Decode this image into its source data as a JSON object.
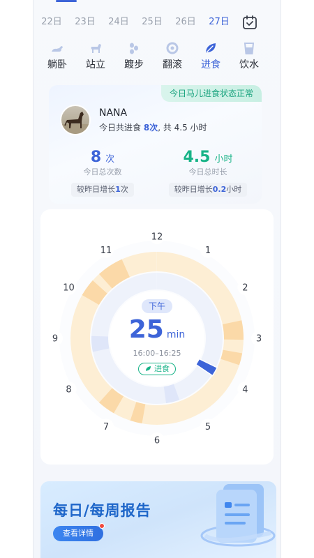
{
  "date_row": {
    "dates": [
      "22日",
      "23日",
      "24日",
      "25日",
      "26日",
      "27日"
    ],
    "active_index": 5
  },
  "categories": [
    {
      "label": "躺卧",
      "icon": "horse-lying-icon"
    },
    {
      "label": "站立",
      "icon": "horse-standing-icon"
    },
    {
      "label": "踱步",
      "icon": "hoofprints-icon"
    },
    {
      "label": "翻滚",
      "icon": "rolling-icon"
    },
    {
      "label": "进食",
      "icon": "leaf-icon"
    },
    {
      "label": "饮水",
      "icon": "water-cup-icon"
    }
  ],
  "active_category_index": 4,
  "summary": {
    "status_badge": "今日马儿进食状态正常",
    "horse_name": "NANA",
    "intake_prefix": "今日共进食",
    "intake_count": "8次",
    "intake_suffix": ", 共 4.5 小时",
    "count_stat": {
      "value": "8",
      "unit": "次",
      "caption": "今日总次数",
      "compare_prefix": "较昨日增长",
      "compare_value": "1",
      "compare_suffix": "次"
    },
    "duration_stat": {
      "value": "4.5",
      "unit": "小时",
      "caption": "今日总时长",
      "compare_prefix": "较昨日增长",
      "compare_value": "0.2",
      "compare_suffix": "小时"
    }
  },
  "clock": {
    "hours": [
      "12",
      "1",
      "2",
      "3",
      "4",
      "5",
      "6",
      "7",
      "8",
      "9",
      "10",
      "11"
    ],
    "period": "下午",
    "selected_duration": "25",
    "selected_unit": "min",
    "selected_range": "16:00–16:25",
    "activity_label": "进食"
  },
  "report": {
    "title": "每日/每周报告",
    "button_label": "查看详情"
  },
  "colors": {
    "accent": "#3d64d8",
    "green": "#17b387",
    "ring_yellow": "#fdeed4",
    "ring_orange": "#fbd9a8",
    "ring_blue": "#dfe6f9"
  }
}
